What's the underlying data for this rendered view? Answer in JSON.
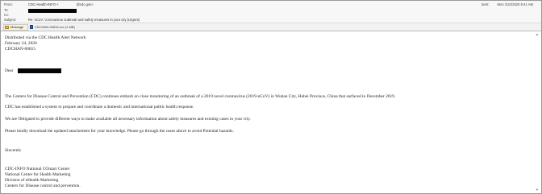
{
  "header": {
    "from_label": "From:",
    "from_value": "CDC-Health-INFO <",
    "from_value_tail": "@cdc.gov>",
    "to_label": "To:",
    "cc_label": "Cc:",
    "subject_label": "Subject:",
    "subject_value": "Re: nCoV: Coronavirus outbreak and safety measures in your city (Urgent)",
    "sent_label": "Sent:",
    "sent_value": "Mon 2/24/2020 8:41 AM"
  },
  "attachments": {
    "message_tab": "Message",
    "file_name": "CDCHAN-00815.xxx (1 MB)"
  },
  "body": {
    "intro_line1": "Distributed via the CDC Health Alert Network",
    "intro_line2": "February 24, 2020",
    "intro_line3": "CDCHAN-00815",
    "dear": "Dear",
    "para1": "The Centers for Disease Control and Prevention (CDC) continues embark on close monitoring of an outbreak of a 2019 novel coronavirus (2019-nCoV) in Wuhan City, Hubei Province, China that surfaced in December 2019.",
    "para2": "CDC has established a system to prepare and coordinate a domestic and international public health response.",
    "para3": "We are Obligated to provide different ways to make available all necessary information about safety measures and existing cases in your city.",
    "para4": "Please kindly download the updated attachement for your knowledge. Please go through the cases above to avoid Potential hazards.",
    "sincerely": "Sincerely",
    "sig1": "CDC-INFO National COntact Center",
    "sig2": "National Center for Health Marketing",
    "sig3": "Division of eHealth Marketing",
    "sig4": "Centers for Disease control and prevention."
  },
  "icons": {
    "message_icon": "envelope-icon",
    "attachment_icon": "document-icon",
    "scroll_up_icon": "chevron-up-icon",
    "scroll_down_icon": "chevron-down-icon"
  }
}
